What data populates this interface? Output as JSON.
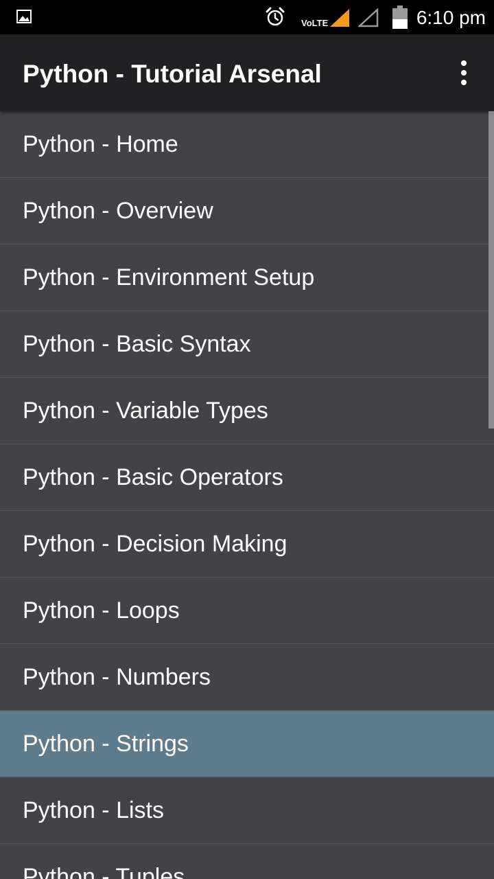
{
  "status_bar": {
    "network_label": "VoLTE",
    "time": "6:10 pm",
    "icons": [
      "gallery-icon",
      "alarm-icon",
      "signal-icon",
      "signal-empty-icon",
      "battery-icon"
    ],
    "signal_color": "#f39a1f"
  },
  "app_bar": {
    "title": "Python - Tutorial Arsenal",
    "menu_icon": "overflow-menu-icon"
  },
  "topics": [
    {
      "label": "Python - Home",
      "selected": false
    },
    {
      "label": "Python - Overview",
      "selected": false
    },
    {
      "label": "Python - Environment Setup",
      "selected": false
    },
    {
      "label": "Python - Basic Syntax",
      "selected": false
    },
    {
      "label": "Python - Variable Types",
      "selected": false
    },
    {
      "label": "Python - Basic Operators",
      "selected": false
    },
    {
      "label": "Python - Decision Making",
      "selected": false
    },
    {
      "label": "Python - Loops",
      "selected": false
    },
    {
      "label": "Python - Numbers",
      "selected": false
    },
    {
      "label": "Python - Strings",
      "selected": true
    },
    {
      "label": "Python - Lists",
      "selected": false
    },
    {
      "label": "Python - Tuples",
      "selected": false
    }
  ],
  "colors": {
    "list_background": "#434246",
    "selected_background": "#5e7b8d",
    "app_bar": "#212023"
  }
}
